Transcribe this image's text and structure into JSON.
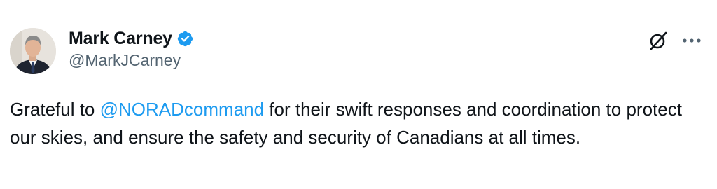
{
  "author": {
    "display_name": "Mark Carney",
    "handle": "@MarkJCarney",
    "verified": true,
    "avatar_icon": "profile-photo"
  },
  "actions": {
    "grok_icon": "grok-icon",
    "more_icon": "more-horizontal-icon"
  },
  "tweet": {
    "text_before_mention": "Grateful to ",
    "mention": "@NORADcommand",
    "text_after_mention": " for their swift responses and coordination to protect our skies, and ensure the safety and security of Canadians at all times."
  },
  "colors": {
    "mention": "#1d9bf0",
    "verified_badge": "#1d9bf0",
    "handle": "#536471",
    "text": "#0f1419"
  }
}
